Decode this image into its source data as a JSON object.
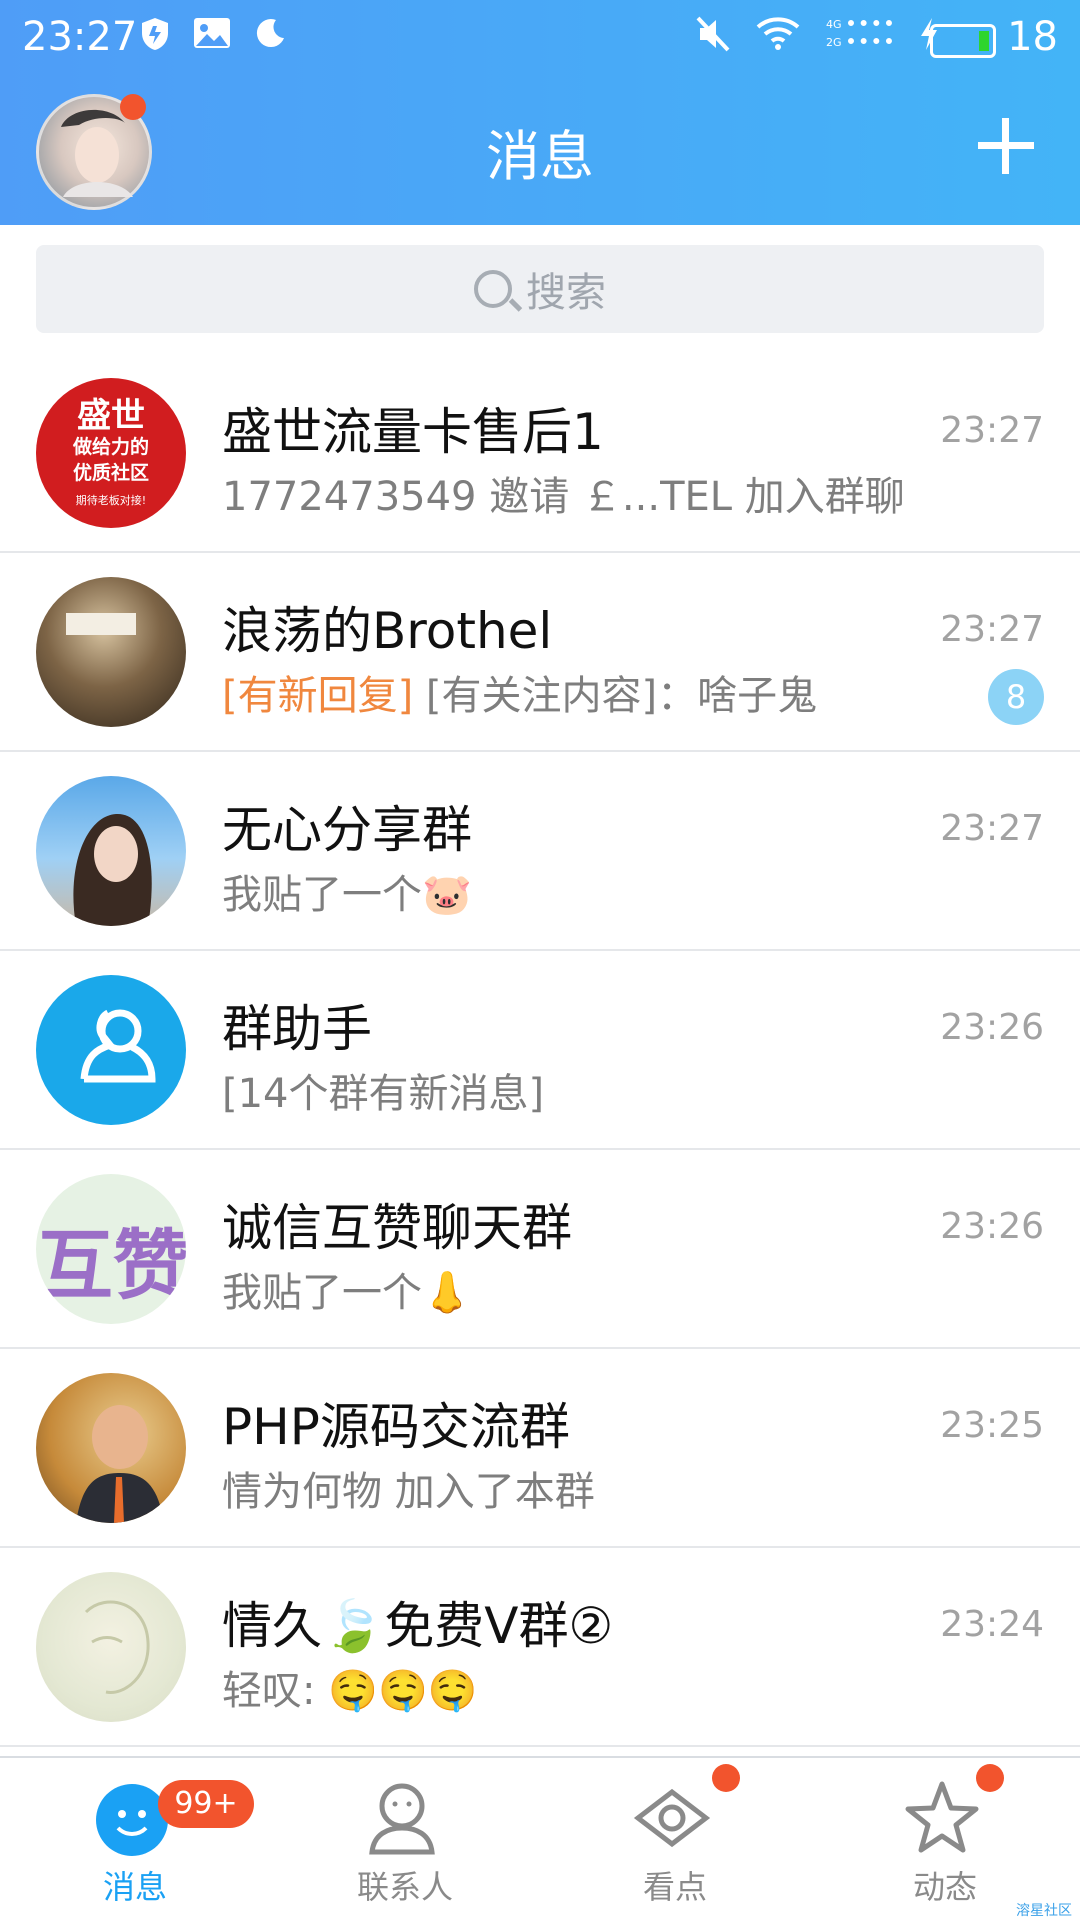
{
  "status_bar": {
    "time": "23:27",
    "network_4g": "4G",
    "network_2g": "2G",
    "battery_level": "18",
    "icons": [
      "shield-icon",
      "image-icon",
      "moon-icon",
      "mute-icon",
      "wifi-icon",
      "signal-icon",
      "charging-icon",
      "battery-icon"
    ]
  },
  "header": {
    "title": "消息",
    "plus_icon": "plus-icon"
  },
  "search": {
    "placeholder": "搜索"
  },
  "conversations": [
    {
      "name": "盛世流量卡售后1",
      "preview": "1772473549 邀请 ￡...TEL 加入群聊",
      "time": "23:27",
      "avatar_text_lines": [
        "盛世",
        "做给力的",
        "优质社区",
        "期待老板对接!"
      ]
    },
    {
      "name": "浪荡的Brothel",
      "preview_tag": "[有新回复]",
      "preview": " [有关注内容]：啥子鬼",
      "time": "23:27",
      "unread": "8"
    },
    {
      "name": "无心分享群",
      "preview": "我贴了一个🐷",
      "time": "23:27"
    },
    {
      "name": "群助手",
      "preview_tag": "[14个群有新消息]",
      "time": "23:26"
    },
    {
      "name": "诚信互赞聊天群",
      "preview": "我贴了一个👃",
      "time": "23:26",
      "avatar_text": "互赞"
    },
    {
      "name": "PHP源码交流群",
      "preview": "情为何物 加入了本群",
      "time": "23:25"
    },
    {
      "name": "情久🍃免费V群②",
      "preview": "轻叹: 🤤🤤🤤",
      "time": "23:24"
    }
  ],
  "tabbar": {
    "tabs": [
      {
        "label": "消息",
        "badge": "99+",
        "icon": "chat-face-icon"
      },
      {
        "label": "联系人",
        "icon": "person-icon"
      },
      {
        "label": "看点",
        "icon": "eye-icon"
      },
      {
        "label": "动态",
        "icon": "star-icon"
      }
    ]
  },
  "watermark": "溶星社区",
  "colors": {
    "header_start": "#4f9df7",
    "header_end": "#43b4f7",
    "accent_blue": "#1aa1f4",
    "badge_red": "#f2542d",
    "preview_orange": "#f0873e",
    "unread_badge": "#8cd3f6"
  }
}
